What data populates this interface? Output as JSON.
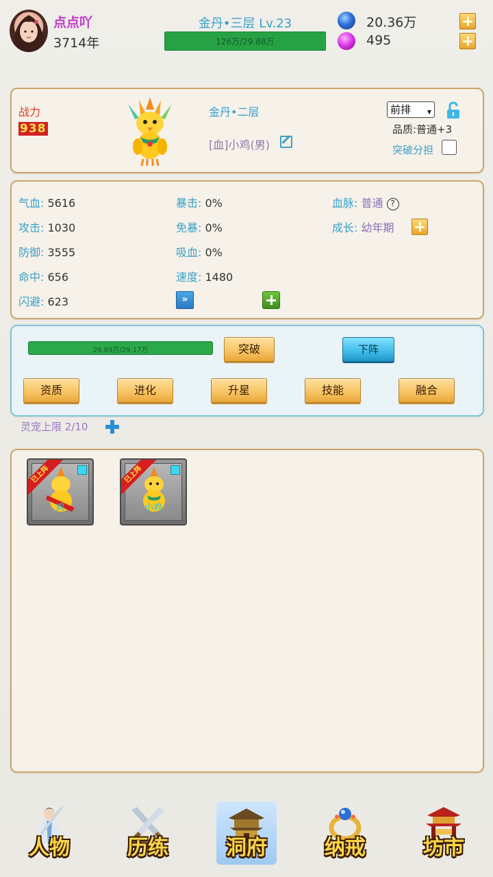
{
  "header": {
    "player_name": "点点吖",
    "player_age": "3714年",
    "realm_title": "金丹•三层 Lv.23",
    "realm_progress_text": "126万/29.88万",
    "realm_progress": 0.99,
    "currency1_value": "20.36万",
    "currency2_value": "495"
  },
  "pet": {
    "combat_label": "战力",
    "combat_value": "938",
    "realm": "金丹•二层",
    "name": "[血]小鸡(男)",
    "position_option": "前排",
    "quality": "品质:普通+3",
    "share_label": "突破分担"
  },
  "stats": {
    "hp_k": "气血:",
    "hp_v": "5616",
    "atk_k": "攻击:",
    "atk_v": "1030",
    "def_k": "防御:",
    "def_v": "3555",
    "hit_k": "命中:",
    "hit_v": "656",
    "dodge_k": "闪避:",
    "dodge_v": "623",
    "crit_k": "暴击:",
    "crit_v": "0%",
    "anticrit_k": "免暴:",
    "anticrit_v": "0%",
    "lifesteal_k": "吸血:",
    "lifesteal_v": "0%",
    "speed_k": "速度:",
    "speed_v": "1480",
    "bloodline_k": "血脉:",
    "bloodline_v": "普通",
    "growth_k": "成长:",
    "growth_v": "幼年期"
  },
  "actions": {
    "exp_text": "29.89万/29.17万",
    "breakthrough_label": "突破",
    "unequip_label": "下阵",
    "aptitude_label": "资质",
    "evolve_label": "进化",
    "star_label": "升星",
    "skill_label": "技能",
    "fuse_label": "融合"
  },
  "pet_cap": "灵宠上限 2/10",
  "pet_list": [
    {
      "ribbon": "已上阵",
      "name": "鸡"
    },
    {
      "ribbon": "已上阵",
      "name": "小鸡"
    }
  ],
  "nav": {
    "character": "人物",
    "training": "历练",
    "cave": "洞府",
    "ring": "纳戒",
    "market": "坊市"
  },
  "colors": {
    "accent_blue": "#3aa0c8",
    "name_purple": "#c03cc8",
    "combat_red": "#e0422b",
    "progress_green": "#2aa84a"
  }
}
